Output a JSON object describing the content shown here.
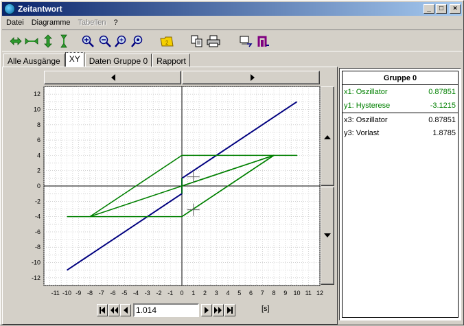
{
  "window": {
    "title": "Zeitantwort"
  },
  "titlebar_buttons": {
    "minimize": "_",
    "maximize": "□",
    "close": "×"
  },
  "menu": [
    "Datei",
    "Diagramme",
    "Tabellen",
    "?"
  ],
  "tabs": [
    "Alle Ausgänge",
    "XY",
    "Daten Gruppe 0",
    "Rapport"
  ],
  "toolbar": {
    "icons": [
      "scroll-horizontal-icon",
      "compress-horizontal-icon",
      "scroll-vertical-icon",
      "compress-vertical-icon",
      "zoom-in-icon",
      "zoom-out-icon",
      "zoom-fit-icon",
      "zoom-reset-icon",
      "folder-icon",
      "copy-icon",
      "print-icon",
      "export-icon",
      "figure-icon"
    ]
  },
  "sidebar": {
    "title": "Gruppe 0",
    "rows": [
      {
        "label": "x1: Oszillator",
        "value": "0.87851",
        "color": "#008000"
      },
      {
        "label": "y1: Hysterese",
        "value": "-3.1215",
        "color": "#008000"
      },
      {
        "label": "x3: Oszillator",
        "value": "0.87851",
        "color": "#000000"
      },
      {
        "label": "y3: Vorlast",
        "value": "1.8785",
        "color": "#000000"
      }
    ]
  },
  "navigation": {
    "time_value": "1.014",
    "unit": "[s]"
  },
  "chart_data": {
    "type": "line",
    "xlim": [
      -12,
      12
    ],
    "ylim": [
      -13,
      13
    ],
    "x_ticks": [
      -11,
      -10,
      -9,
      -8,
      -7,
      -6,
      -5,
      -4,
      -3,
      -2,
      -1,
      0,
      1,
      2,
      3,
      4,
      5,
      6,
      7,
      8,
      9,
      10,
      11,
      12
    ],
    "y_ticks": [
      -12,
      -10,
      -8,
      -6,
      -4,
      -2,
      0,
      2,
      4,
      6,
      8,
      10,
      12
    ],
    "grid": true,
    "series": [
      {
        "color": "#00007f",
        "points": [
          [
            -10,
            -11
          ],
          [
            0,
            -1
          ],
          [
            0,
            1
          ],
          [
            10,
            11
          ]
        ]
      },
      {
        "color": "#008000",
        "points": [
          [
            -10,
            -4
          ],
          [
            0,
            -4
          ],
          [
            8,
            4
          ],
          [
            10,
            4
          ],
          [
            0,
            4
          ],
          [
            -8,
            -4
          ],
          [
            -10,
            -4
          ]
        ]
      },
      {
        "color": "#008000",
        "points": [
          [
            0,
            0
          ],
          [
            8,
            4
          ],
          [
            0,
            -4
          ]
        ]
      },
      {
        "color": "#008000",
        "points": [
          [
            0,
            -1
          ],
          [
            0,
            1
          ],
          [
            0,
            0
          ],
          [
            8,
            4
          ],
          [
            -8,
            -4
          ]
        ]
      }
    ],
    "cursors": [
      [
        1.0,
        1.2
      ],
      [
        1.0,
        -3.1
      ]
    ]
  }
}
